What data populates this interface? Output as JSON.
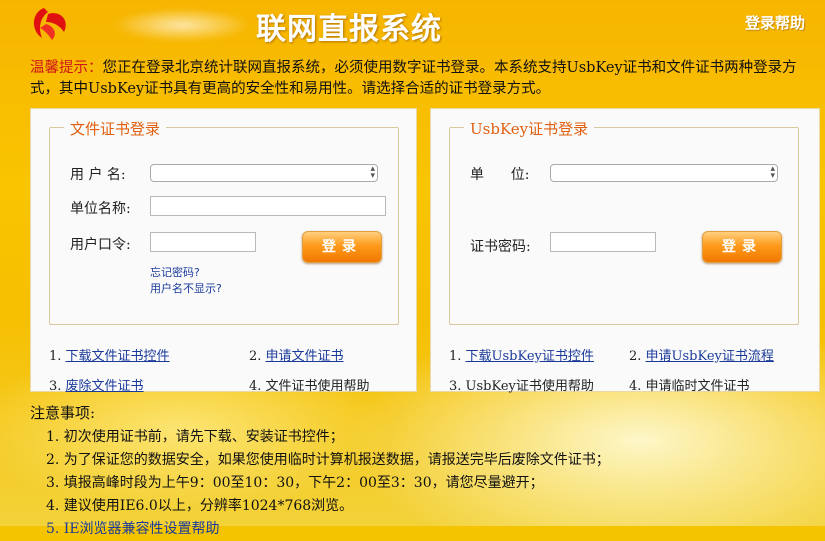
{
  "header": {
    "title": "联网直报系统",
    "login_help": "登录帮助"
  },
  "tip": {
    "label": "温馨提示：",
    "text": "您正在登录北京统计联网直报系统，必须使用数字证书登录。本系统支持UsbKey证书和文件证书两种登录方式，其中UsbKey证书具有更高的安全性和易用性。请选择合适的证书登录方式。"
  },
  "file_login": {
    "legend": "文件证书登录",
    "username_label": "用 户 名:",
    "unit_name_label": "单位名称:",
    "password_label": "用户口令:",
    "login_button": "登录",
    "forgot_password": "忘记密码?",
    "username_hidden": "用户名不显示?",
    "links": [
      {
        "num": "1.",
        "text": "下载文件证书控件",
        "link": true
      },
      {
        "num": "2.",
        "text": "申请文件证书",
        "link": true
      },
      {
        "num": "3.",
        "text": "废除文件证书",
        "link": true
      },
      {
        "num": "4.",
        "text": "文件证书使用帮助",
        "link": false
      }
    ]
  },
  "usbkey_login": {
    "legend": "UsbKey证书登录",
    "unit_label": "单      位:",
    "cert_password_label": "证书密码:",
    "login_button": "登录",
    "links": [
      {
        "num": "1.",
        "text": "下载UsbKey证书控件",
        "link": true
      },
      {
        "num": "2.",
        "text": "申请UsbKey证书流程",
        "link": true
      },
      {
        "num": "3.",
        "text": "UsbKey证书使用帮助",
        "link": false
      },
      {
        "num": "4.",
        "text": "申请临时文件证书",
        "link": false
      }
    ]
  },
  "notes": {
    "title": "注意事项:",
    "items": [
      "1. 初次使用证书前，请先下载、安装证书控件；",
      "2. 为了保证您的数据安全，如果您使用临时计算机报送数据，请报送完毕后废除文件证书；",
      "3. 填报高峰时段为上午9：00至10：30，下午2：00至3：30，请您尽量避开；",
      "4. 建议使用IE6.0以上，分辨率1024*768浏览。",
      "5. IE浏览器兼容性设置帮助"
    ]
  },
  "colors": {
    "background": "#f5c400",
    "tip_label": "#d01818",
    "legend": "#e06010",
    "link": "#1a3a9a",
    "button": "#f07800"
  }
}
